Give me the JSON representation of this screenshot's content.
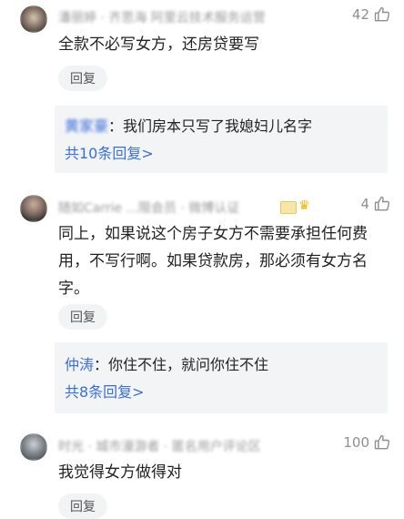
{
  "comments": [
    {
      "username": "潘丽婷 · 齐思海 阿里云技术服务运营",
      "likes": "42",
      "text": "全款不必写女方，还房贷要写",
      "reply_label": "回复",
      "sub_reply": {
        "author": "黄家豪",
        "text": "：我们房本只写了我媳妇儿名字"
      },
      "more_replies": "共10条回复>"
    },
    {
      "username": "随如Carrie ...限会员 · 微博认证",
      "likes": "4",
      "text": "同上，如果说这个房子女方不需要承担任何费\n用，不写行啊。如果贷款房，那必须有女方名\n字。",
      "reply_label": "回复",
      "sub_reply": {
        "author": "仲涛",
        "text": "：你住不住，就问你住不住"
      },
      "more_replies": "共8条回复>"
    },
    {
      "username": "时光 · 城市漫游者 · 匿名用户评论区",
      "likes": "100",
      "text": "我觉得女方做得对",
      "reply_label": "回复"
    }
  ],
  "icons": {
    "like": "thumbs-up-icon",
    "vip": "vip-badge-icon",
    "crown": "crown-icon"
  },
  "colors": {
    "link": "#3b6fd8",
    "reply_bg": "#f3f4f6",
    "muted": "#8e8e8e"
  }
}
